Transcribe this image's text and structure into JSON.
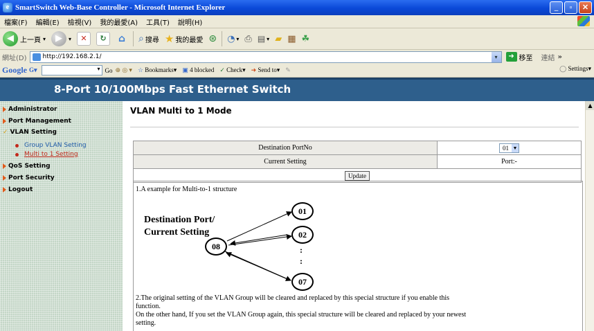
{
  "window": {
    "title": "SmartSwitch Web-Base Controller - Microsoft Internet Explorer"
  },
  "menubar": [
    "檔案(F)",
    "編輯(E)",
    "檢視(V)",
    "我的最愛(A)",
    "工具(T)",
    "說明(H)"
  ],
  "toolbar": {
    "back": "上一頁",
    "search": "搜尋",
    "favorites": "我的最愛"
  },
  "address": {
    "label": "網址(D)",
    "url": "http://192.168.2.1/",
    "go": "移至",
    "links": "連結"
  },
  "googlebar": {
    "logo": "Google",
    "go": "Go",
    "bookmarks": "Bookmarks",
    "blocked": "4 blocked",
    "check": "Check",
    "sendto": "Send to",
    "settings": "Settings"
  },
  "banner": {
    "title": "8-Port 10/100Mbps  Fast Ethernet Switch"
  },
  "sidebar": {
    "items": [
      "Administrator",
      "Port Management",
      "VLAN Setting",
      "QoS Setting",
      "Port Security",
      "Logout"
    ],
    "subitems": [
      "Group VLAN Setting",
      "Multi to 1 Setting"
    ]
  },
  "main": {
    "title": "VLAN Multi to 1 Mode",
    "dest_label": "Destination PortNo",
    "dest_value": "01",
    "current_label": "Current Setting",
    "current_value": "Port:-",
    "update": "Update",
    "example_title": "1.A example for Multi-to-1 structure",
    "diagram": {
      "label_line1": "Destination Port/",
      "label_line2": "Current Setting",
      "center": "08",
      "targets": [
        "01",
        "02",
        "07"
      ],
      "dots": ":"
    },
    "note_line1": "2.The original setting of the VLAN Group will be cleared and replaced by this special structure if you enable this",
    "note_line2": "function.",
    "note_line3": "On the other hand, If you set the VLAN Group again, this special structure will be cleared and replaced by your newest",
    "note_line4": "setting."
  }
}
